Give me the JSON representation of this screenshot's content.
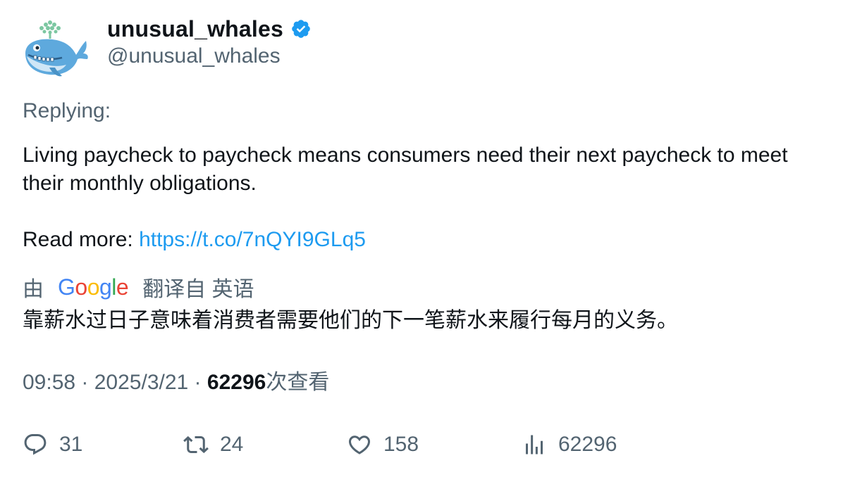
{
  "author": {
    "display_name": "unusual_whales",
    "handle": "@unusual_whales",
    "verified": true,
    "verified_color": "#1d9bf0"
  },
  "tweet": {
    "replying_label": "Replying:",
    "text": "Living paycheck to paycheck means consumers need their next paycheck to meet their monthly obligations.",
    "read_more_label": "Read more: ",
    "link": "https://t.co/7nQYI9GLq5",
    "link_color": "#1d9bf0"
  },
  "translation": {
    "prefix": "由",
    "provider_letters": [
      "G",
      "o",
      "o",
      "g",
      "l",
      "e"
    ],
    "suffix": "翻译自 英语",
    "text": "靠薪水过日子意味着消费者需要他们的下一笔薪水来履行每月的义务。"
  },
  "meta": {
    "time": "09:58",
    "separator": " · ",
    "date": "2025/3/21",
    "views_count": "62296",
    "views_label": "次查看"
  },
  "actions": {
    "reply_count": "31",
    "retweet_count": "24",
    "like_count": "158",
    "views_count": "62296",
    "icons": [
      "reply-icon",
      "retweet-icon",
      "like-icon",
      "views-icon"
    ]
  }
}
